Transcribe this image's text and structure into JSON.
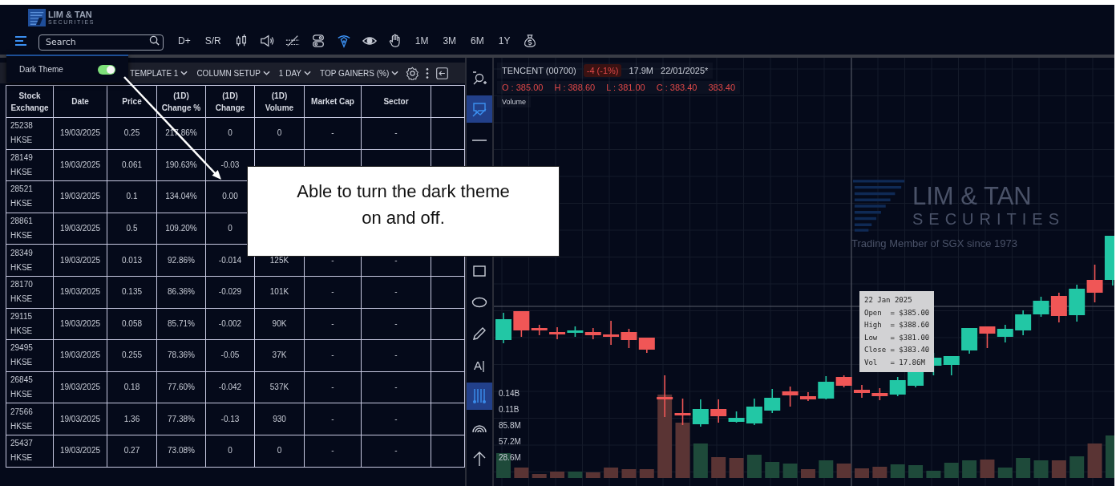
{
  "logo": {
    "name": "LIM & TAN",
    "tagline": "SECURITIES"
  },
  "toolbar": {
    "search": {
      "placeholder": "Search"
    },
    "items": [
      {
        "kind": "text",
        "label": "D+",
        "selected": false
      },
      {
        "kind": "text",
        "label": "S/R",
        "selected": false
      },
      {
        "kind": "candles",
        "selected": false
      },
      {
        "kind": "speaker",
        "selected": false
      },
      {
        "kind": "crossed-lines",
        "selected": false
      },
      {
        "kind": "switches",
        "selected": false
      },
      {
        "kind": "pen",
        "selected": true
      },
      {
        "kind": "eye",
        "selected": false
      },
      {
        "kind": "hand",
        "selected": false
      },
      {
        "kind": "text",
        "label": "1M",
        "selected": false
      },
      {
        "kind": "text",
        "label": "3M",
        "selected": false
      },
      {
        "kind": "text",
        "label": "6M",
        "selected": false
      },
      {
        "kind": "text",
        "label": "1Y",
        "selected": false
      },
      {
        "kind": "money-bag",
        "selected": false
      }
    ]
  },
  "theme_popup": {
    "label": "Dark Theme",
    "on": true
  },
  "options_bar": {
    "dropdowns": [
      "TEMPLATE 1",
      "COLUMN SETUP",
      "1 DAY",
      "TOP GAINERS (%)"
    ]
  },
  "table": {
    "columns": [
      "Stock\nExchange",
      "Date",
      "Price",
      "(1D)\nChange %",
      "(1D)\nChange",
      "(1D)\nVolume",
      "Market Cap",
      "Sector"
    ],
    "rows": [
      [
        "25238\nHKSE",
        "19/03/2025",
        "0.25",
        "217.86%",
        "0",
        "0",
        "-",
        "-"
      ],
      [
        "28149\nHKSE",
        "19/03/2025",
        "0.061",
        "190.63%",
        "-0.03",
        null,
        null,
        null
      ],
      [
        "28521\nHKSE",
        "19/03/2025",
        "0.1",
        "134.04%",
        "0.00",
        null,
        null,
        null
      ],
      [
        "28861\nHKSE",
        "19/03/2025",
        "0.5",
        "109.20%",
        "0",
        null,
        null,
        null
      ],
      [
        "28349\nHKSE",
        "19/03/2025",
        "0.013",
        "92.86%",
        "-0.014",
        "125K",
        "-",
        "-"
      ],
      [
        "28170\nHKSE",
        "19/03/2025",
        "0.135",
        "86.36%",
        "-0.029",
        "101K",
        "-",
        "-"
      ],
      [
        "29115\nHKSE",
        "19/03/2025",
        "0.058",
        "85.71%",
        "-0.002",
        "90K",
        "-",
        "-"
      ],
      [
        "29495\nHKSE",
        "19/03/2025",
        "0.255",
        "78.36%",
        "-0.05",
        "37K",
        "-",
        "-"
      ],
      [
        "26845\nHKSE",
        "19/03/2025",
        "0.18",
        "77.60%",
        "-0.042",
        "537K",
        "-",
        "-"
      ],
      [
        "27566\nHKSE",
        "19/03/2025",
        "1.36",
        "77.38%",
        "-0.13",
        "930",
        "-",
        "-"
      ],
      [
        "25437\nHKSE",
        "19/03/2025",
        "0.27",
        "73.08%",
        "0",
        "0",
        "-",
        "-"
      ]
    ]
  },
  "chart_tools": {
    "top": [
      {
        "kind": "zoom",
        "selected": false
      },
      {
        "kind": "annotation",
        "selected": true
      },
      {
        "kind": "line",
        "selected": false
      }
    ],
    "bottom": [
      {
        "kind": "rectangle",
        "selected": false
      },
      {
        "kind": "ellipse",
        "selected": false
      },
      {
        "kind": "pencil",
        "selected": false
      },
      {
        "kind": "text",
        "label": "A|",
        "selected": false
      },
      {
        "kind": "fib",
        "selected": true
      },
      {
        "kind": "arcs",
        "selected": false
      },
      {
        "kind": "arrow",
        "selected": false
      }
    ]
  },
  "chart": {
    "symbol": "TENCENT (00700)",
    "change": "-4 (-1%)",
    "volume": "17.9M",
    "date": "22/01/2025*",
    "ohlc": [
      "O : 385.00",
      "H : 388.60",
      "L : 381.00",
      "C : 383.40",
      "383.40"
    ],
    "study": "Volume",
    "volume_axis_labels": [
      "0.14B",
      "0.11B",
      "85.8M",
      "57.2M",
      "28.6M"
    ],
    "tooltip": [
      "22 Jan 2025",
      "Open  = $385.00",
      "High  = $388.60",
      "Low   = $381.00",
      "Close = $383.40",
      "Vol   = 17.86M"
    ],
    "watermark": {
      "name": "LIM & TAN",
      "tagline": "SECURITIES",
      "note": "Trading Member of SGX since 1973"
    }
  },
  "callout": "Able to turn the dark theme on and off."
}
